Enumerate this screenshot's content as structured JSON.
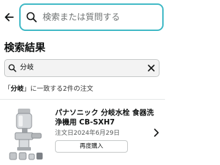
{
  "header": {
    "search_placeholder": "検索または質問する"
  },
  "results": {
    "title": "検索結果"
  },
  "filter": {
    "value": "分岐"
  },
  "summary": {
    "open_quote": "「",
    "keyword": "分岐",
    "rest": "」に一致する2件の注文"
  },
  "order": {
    "title": "パナソニック 分岐水栓 食器洗浄機用 CB-SXH7",
    "date": "注文日2024年6月29日",
    "reorder_label": "再度購入"
  },
  "colors": {
    "search_border": "#3ab7c4",
    "text": "#0f1111",
    "muted": "#565959"
  },
  "icons": {
    "back": "back-arrow-icon",
    "search": "search-icon",
    "filter_search": "search-icon",
    "clear": "close-icon",
    "chevron": "chevron-right-icon"
  }
}
